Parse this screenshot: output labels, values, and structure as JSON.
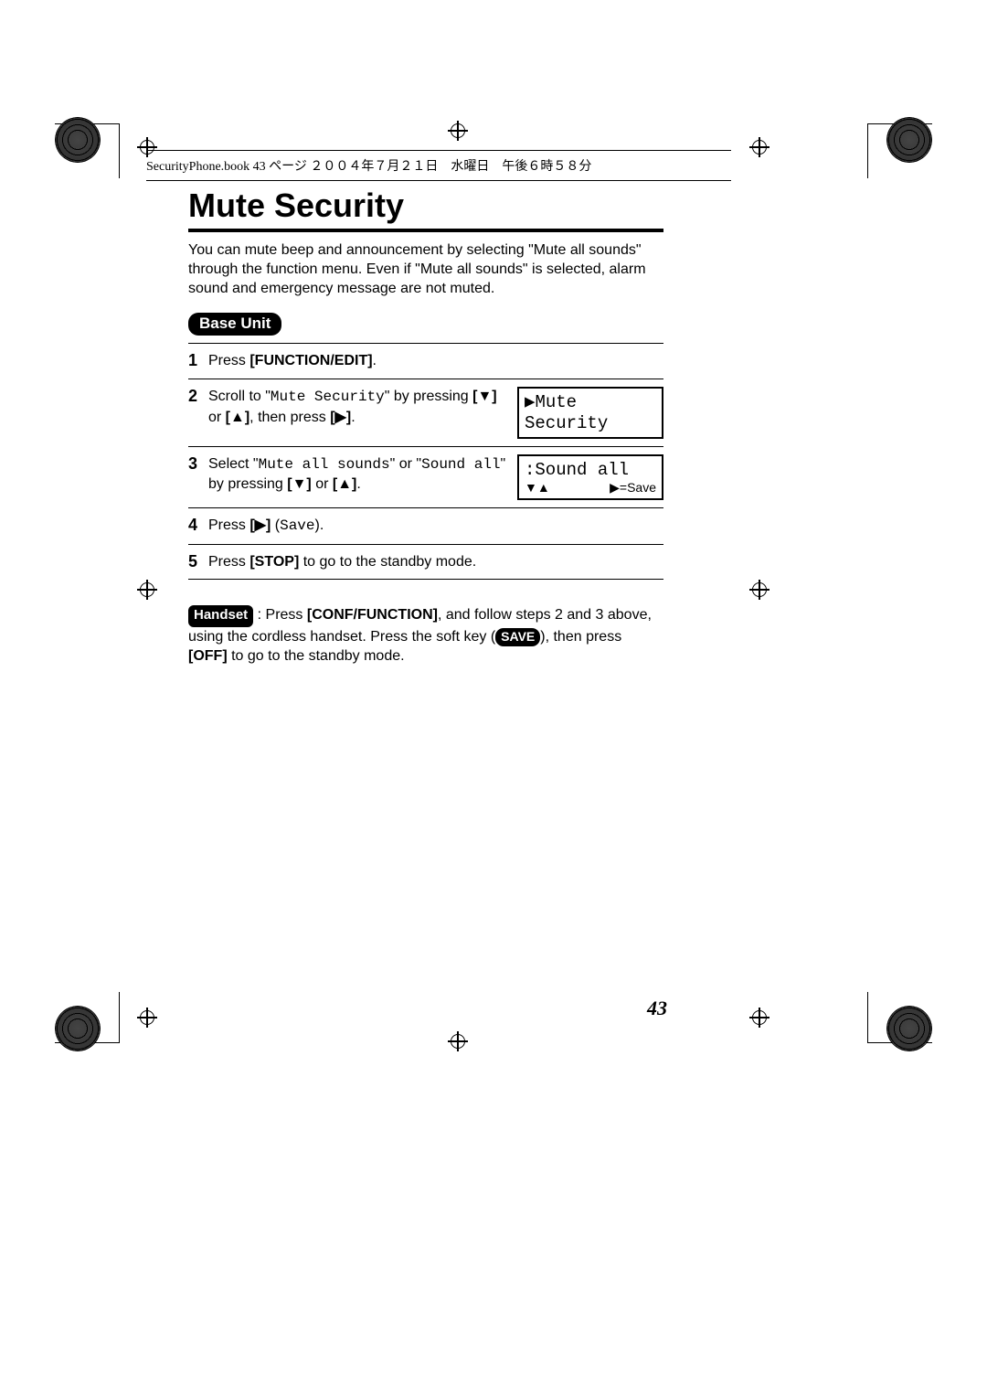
{
  "running_head": "SecurityPhone.book  43 ページ  ２００４年７月２１日　水曜日　午後６時５８分",
  "title": "Mute Security",
  "intro": "You can mute beep and announcement by selecting \"Mute all sounds\" through the function menu. Even if \"Mute all sounds\" is selected, alarm sound and emergency message are not muted.",
  "section_label": "Base Unit",
  "steps": {
    "n1": "1",
    "t1_a": "Press ",
    "t1_b": "[FUNCTION/EDIT]",
    "t1_c": ".",
    "n2": "2",
    "t2_a": "Scroll to \"",
    "t2_code": "Mute Security",
    "t2_b": "\" by pressing ",
    "t2_key1": "[▼]",
    "t2_c": " or ",
    "t2_key2": "[▲]",
    "t2_d": ", then press ",
    "t2_key3": "[▶]",
    "t2_e": ".",
    "lcd2": "▶Mute Security",
    "n3": "3",
    "t3_a": "Select \"",
    "t3_code1": "Mute all sounds",
    "t3_b": "\" or \"",
    "t3_code2": "Sound all",
    "t3_c": "\" by pressing ",
    "t3_key1": "[▼]",
    "t3_d": " or ",
    "t3_key2": "[▲]",
    "t3_e": ".",
    "lcd3_line1": ":Sound all",
    "lcd3_sub_left": "▼▲",
    "lcd3_sub_right": "▶=Save",
    "n4": "4",
    "t4_a": "Press ",
    "t4_key": "[▶]",
    "t4_b": " (",
    "t4_code": "Save",
    "t4_c": ").",
    "n5": "5",
    "t5_a": "Press ",
    "t5_key": "[STOP]",
    "t5_b": " to go to the standby mode."
  },
  "handset": {
    "pill": "Handset",
    "a": " : Press ",
    "b": "[CONF/FUNCTION]",
    "c": ", and follow steps 2 and 3 above, using the cordless handset. Press the soft key (",
    "save": "SAVE",
    "d": "), then press ",
    "e": "[OFF]",
    "f": " to go to the standby mode."
  },
  "page_number": "43"
}
